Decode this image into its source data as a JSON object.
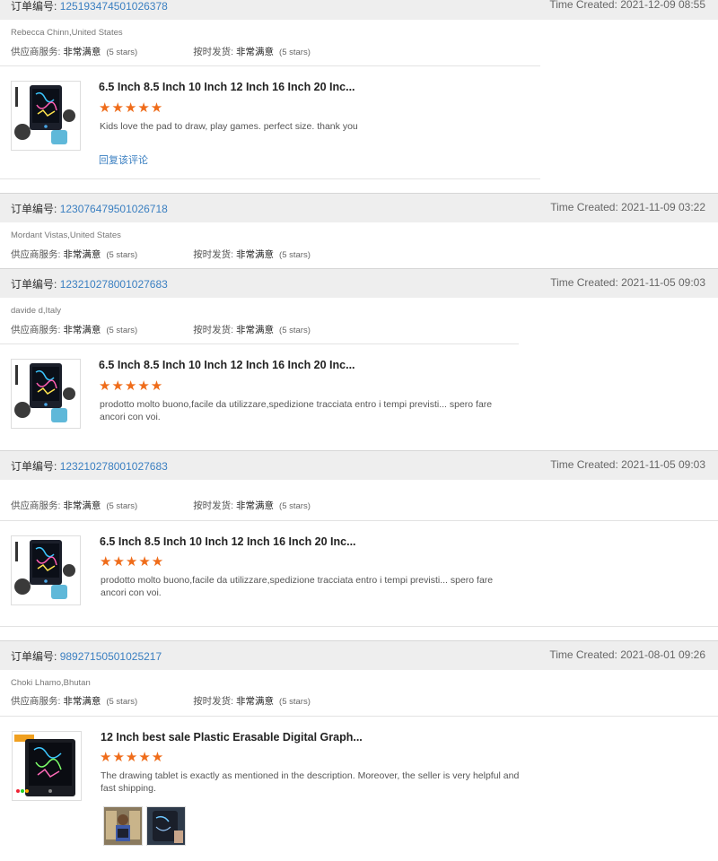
{
  "labels": {
    "order_prefix": "订单编号:",
    "time_prefix": "Time Created:",
    "supplier_service": "供应商服务:",
    "on_time_delivery": "按时发货:",
    "very_satisfied": "非常满意",
    "five_stars": "(5 stars)",
    "reply": "回复该评论"
  },
  "stars_glyph": "★★★★★",
  "accent_color": "#ef6c1a",
  "link_color": "#3a7fc1",
  "orders": [
    {
      "order_no": "125193474501026378",
      "time": "2021-12-09 08:55",
      "buyer": "Rebecca Chinn,United States",
      "rating_stars": 5,
      "product_title": "6.5 Inch 8.5 Inch 10 Inch 12 Inch 16 Inch 20 Inc...",
      "review": "Kids love the pad to draw, play games.  perfect size.  thank you",
      "thumb_icon": "lcd-writing-tablet-thumbnail"
    },
    {
      "order_no": "123076479501026718",
      "time": "2021-11-09 03:22",
      "buyer": "Mordant Vistas,United States"
    },
    {
      "order_no": "123210278001027683",
      "time": "2021-11-05 09:03",
      "buyer": "davide d,Italy",
      "rating_stars": 5,
      "product_title": "6.5 Inch 8.5 Inch 10 Inch 12 Inch 16 Inch 20 Inc...",
      "review": "prodotto molto buono,facile da utilizzare,spedizione tracciata entro i tempi previsti... spero fare ancori con voi.",
      "thumb_icon": "lcd-writing-tablet-thumbnail"
    },
    {
      "order_no": "123210278001027683",
      "time": "2021-11-05 09:03",
      "buyer": "",
      "rating_stars": 5,
      "product_title": "6.5 Inch 8.5 Inch 10 Inch 12 Inch 16 Inch 20 Inc...",
      "review": "prodotto molto buono,facile da utilizzare,spedizione tracciata entro i tempi previsti... spero fare ancori con voi.",
      "thumb_icon": "lcd-writing-tablet-thumbnail"
    },
    {
      "order_no": "98927150501025217",
      "time": "2021-08-01 09:26",
      "buyer": "Choki Lhamo,Bhutan",
      "rating_stars": 5,
      "product_title": "12 Inch best sale Plastic Erasable Digital Graph...",
      "review": "The drawing tablet is exactly as mentioned in the description. Moreover, the seller is very helpful and fast shipping.",
      "thumb_icon": "12-inch-drawing-tablet-thumbnail",
      "photos": [
        "review-photo-1",
        "review-photo-2"
      ]
    }
  ]
}
